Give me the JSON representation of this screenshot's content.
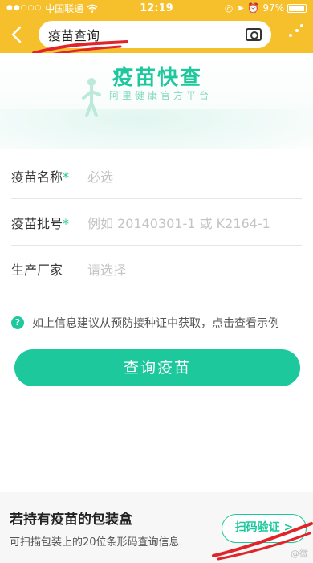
{
  "status": {
    "carrier": "中国联通",
    "time": "12:19",
    "battery": "97%",
    "battery_level": 0.97
  },
  "nav": {
    "search_query": "疫苗查询"
  },
  "hero": {
    "title": "疫苗快查",
    "subtitle": "阿里健康官方平台"
  },
  "form": {
    "fields": [
      {
        "label": "疫苗名称",
        "required": "*",
        "placeholder": "必选"
      },
      {
        "label": "疫苗批号",
        "required": "*",
        "placeholder": "例如 20140301-1 或 K2164-1"
      },
      {
        "label": "生产厂家",
        "required": "",
        "placeholder": "请选择"
      }
    ]
  },
  "hint": {
    "icon": "question-icon",
    "text": "如上信息建议从预防接种证中获取，点击查看示例"
  },
  "main_button": "查询疫苗",
  "footer": {
    "title": "若持有疫苗的包装盒",
    "desc": "可扫描包装上的20位条形码查询信息",
    "scan_button": "扫码验证 >",
    "watermark": "@微"
  },
  "colors": {
    "nav": "#f6c02c",
    "accent": "#1dc89c",
    "annotation": "#e0242a"
  }
}
